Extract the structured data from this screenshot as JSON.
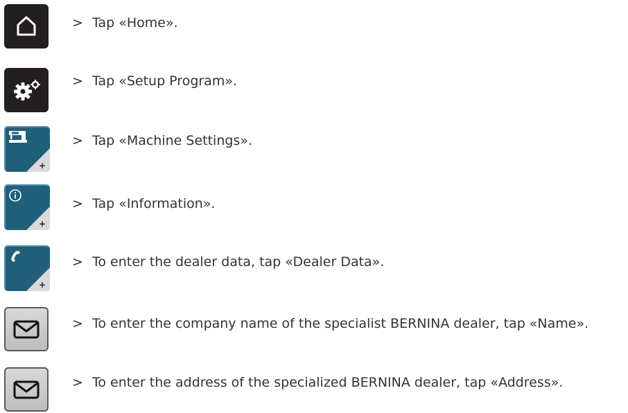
{
  "steps": [
    {
      "icon": "home-icon",
      "marker": ">",
      "text": "Tap «Home»."
    },
    {
      "icon": "gear-icon",
      "marker": ">",
      "text": "Tap «Setup Program»."
    },
    {
      "icon": "sewing-machine-icon",
      "marker": ">",
      "text": "Tap «Machine Settings»."
    },
    {
      "icon": "info-icon",
      "marker": ">",
      "text": "Tap «Information»."
    },
    {
      "icon": "phone-icon",
      "marker": ">",
      "text": "To enter the dealer data, tap «Dealer Data»."
    },
    {
      "icon": "envelope-icon",
      "marker": ">",
      "text": "To enter the company name of the specialist BERNINA dealer, tap «Name»."
    },
    {
      "icon": "envelope-icon",
      "marker": ">",
      "text": "To enter the address of the specialized BERNINA dealer, tap «Address»."
    }
  ],
  "colors": {
    "dark_button": "#231f20",
    "blue_button": "#1f5f7a",
    "grey_button": "#c8c8c8",
    "text": "#333333"
  }
}
